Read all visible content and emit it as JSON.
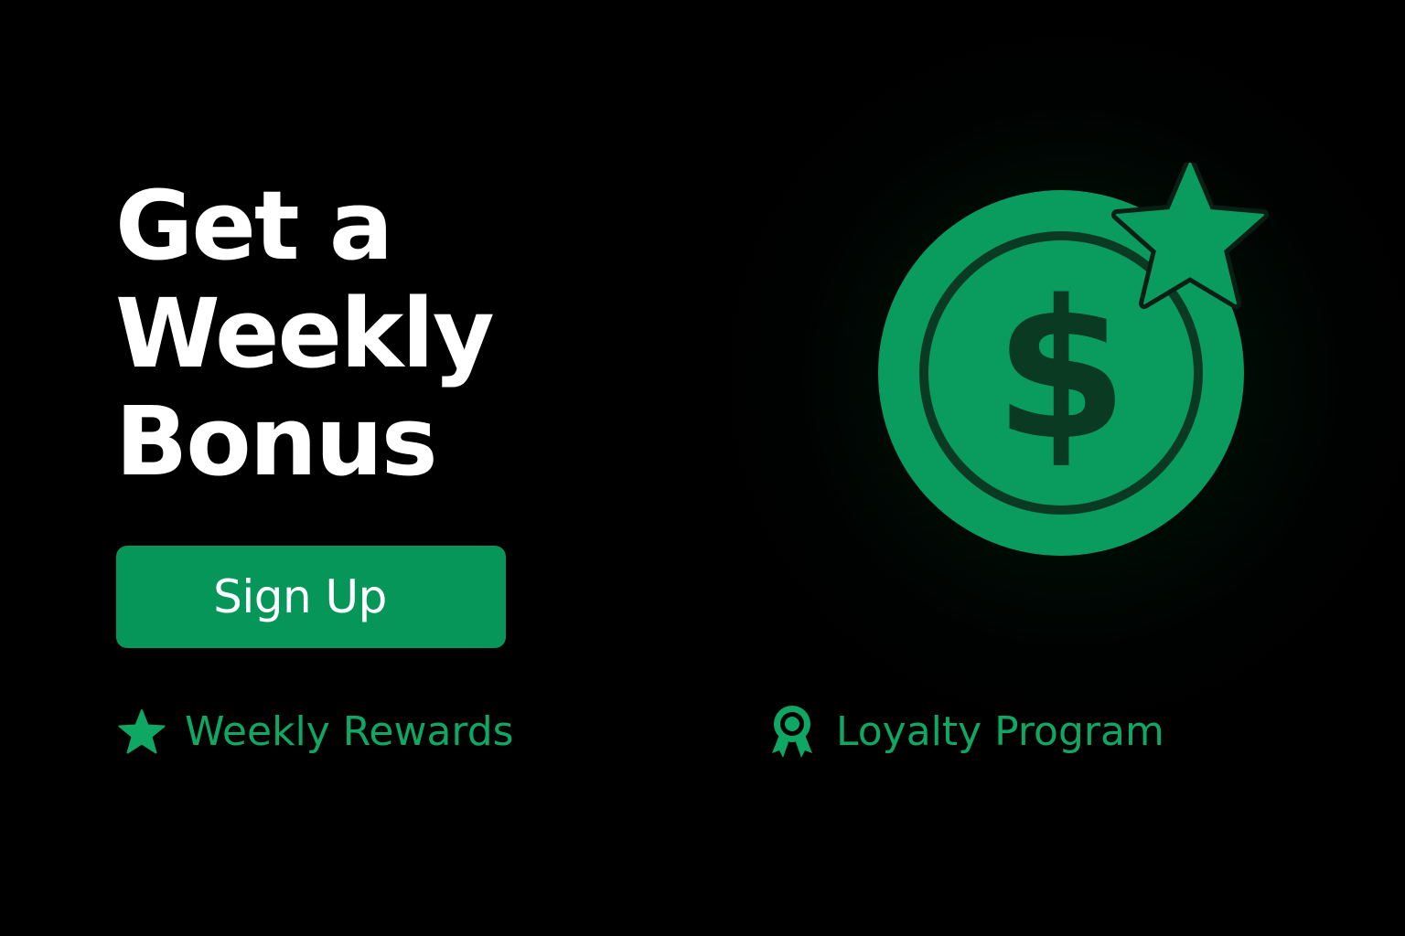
{
  "hero": {
    "headline_lines": [
      "Get a",
      "Weekly",
      "Bonus"
    ],
    "cta_label": "Sign Up",
    "illustration_icon": "dollar-coin-with-star-icon"
  },
  "features": [
    {
      "label": "Weekly Rewards",
      "icon": "star-icon"
    },
    {
      "label": "Loyalty Program",
      "icon": "award-ribbon-icon"
    }
  ],
  "colors": {
    "background": "#000000",
    "accent": "#06965a",
    "accent_text": "#0ea864",
    "headline": "#ffffff",
    "coin": "#0a9c5f",
    "coin_detail": "#0a2a18"
  }
}
